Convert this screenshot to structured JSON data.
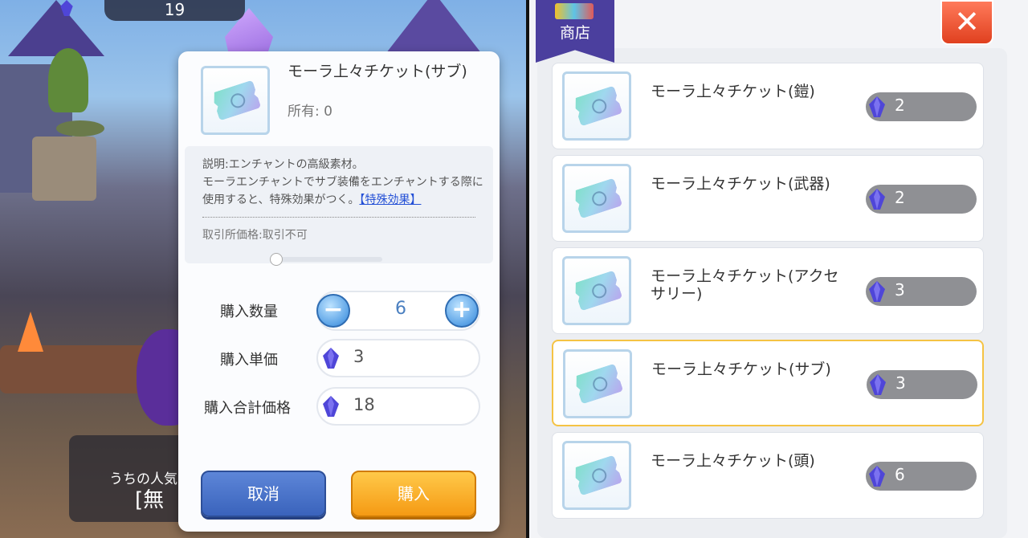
{
  "game": {
    "top_counter": "19",
    "chat_preview": "うちの人気",
    "chat_sub": "[無"
  },
  "dialog": {
    "item_name": "モーラ上々チケット(サブ)",
    "owned": "所有: 0",
    "description_line1": "説明:エンチャントの高級素材。",
    "description_line2": "モーラエンチャントでサブ装備をエンチャントする際に使用すると、特殊効果がつく。",
    "special_link": "【特殊効果】",
    "trade_price": "取引所価格:取引不可",
    "quantity_label": "購入数量",
    "quantity_value": "6",
    "unit_price_label": "購入単価",
    "unit_price_value": "3",
    "total_label": "購入合計価格",
    "total_value": "18",
    "cancel_label": "取消",
    "buy_label": "購入"
  },
  "shop": {
    "tab_label": "商店",
    "close_label": "✕",
    "items": [
      {
        "name": "モーラ上々チケット(鎧)",
        "price": "2",
        "selected": false
      },
      {
        "name": "モーラ上々チケット(武器)",
        "price": "2",
        "selected": false
      },
      {
        "name": "モーラ上々チケット(アクセサリー)",
        "price": "3",
        "selected": false
      },
      {
        "name": "モーラ上々チケット(サブ)",
        "price": "3",
        "selected": true
      },
      {
        "name": "モーラ上々チケット(頭)",
        "price": "6",
        "selected": false
      }
    ]
  },
  "colors": {
    "accent_blue": "#4a7fc0",
    "buy_orange": "#f59a14",
    "cancel_blue": "#3a63bc",
    "selected_border": "#f5c344",
    "shop_tab": "#4b3f9e",
    "close_red": "#e0401f"
  },
  "icons": {
    "currency": "blue-crystal-gem-icon",
    "item": "ticket-icon",
    "minus": "minus-icon",
    "plus": "plus-icon",
    "close": "close-icon"
  }
}
